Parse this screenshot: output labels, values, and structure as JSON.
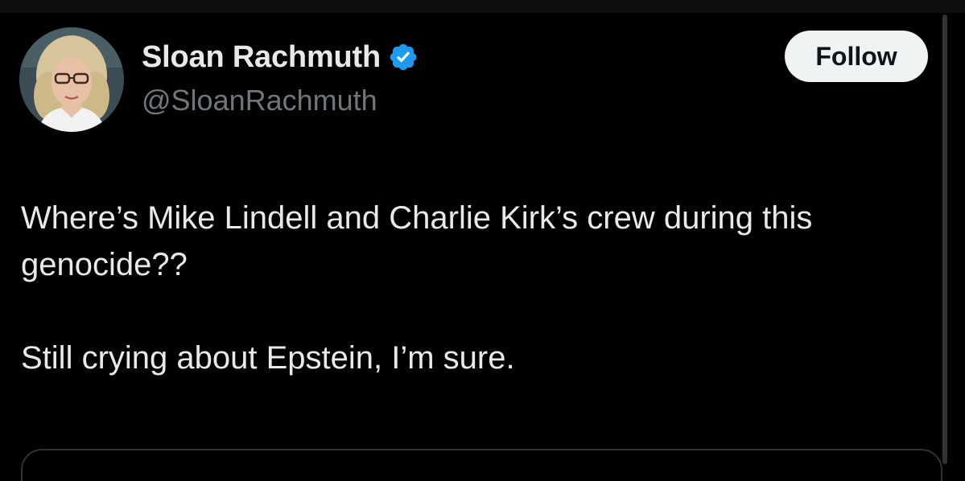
{
  "colors": {
    "background": "#000000",
    "text_primary": "#e7e9ea",
    "text_secondary": "#71767b",
    "verified_badge": "#1d9bf0",
    "follow_button_bg": "#eff3f4",
    "follow_button_text": "#0f1419",
    "border": "#2f3336"
  },
  "tweet": {
    "author": {
      "display_name": "Sloan Rachmuth",
      "handle": "@SloanRachmuth",
      "verified": true,
      "avatar_icon": "profile-photo"
    },
    "follow_label": "Follow",
    "text_paragraphs": [
      "Where’s Mike Lindell and Charlie Kirk’s crew during this genocide??",
      "Still crying about Epstein, I’m sure."
    ]
  }
}
